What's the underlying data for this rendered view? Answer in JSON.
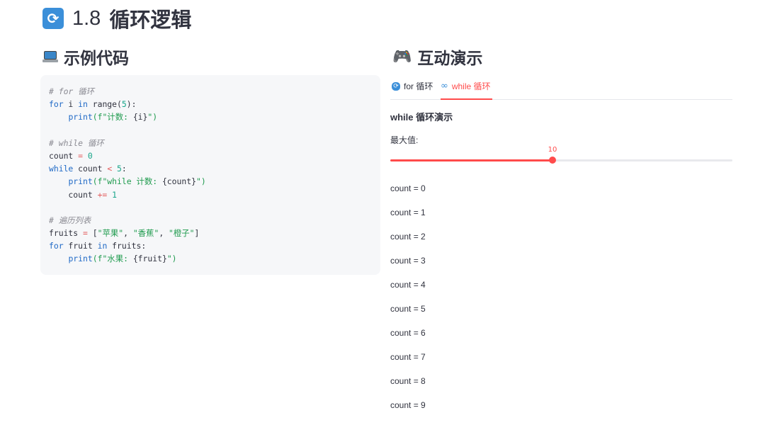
{
  "page": {
    "title_number": "1.8",
    "title_text": "循环逻辑"
  },
  "left": {
    "heading": "示例代码"
  },
  "right": {
    "heading": "互动演示"
  },
  "code_lines": [
    [
      {
        "t": "# for 循环",
        "c": "c-com"
      }
    ],
    [
      {
        "t": "for",
        "c": "c-kw"
      },
      {
        "t": " i ",
        "c": "c-plain"
      },
      {
        "t": "in",
        "c": "c-kw"
      },
      {
        "t": " range(",
        "c": "c-plain"
      },
      {
        "t": "5",
        "c": "c-num"
      },
      {
        "t": "):",
        "c": "c-plain"
      }
    ],
    [
      {
        "t": "    ",
        "c": "c-plain"
      },
      {
        "t": "print",
        "c": "c-fn"
      },
      {
        "t": "(f\"计数: ",
        "c": "c-str"
      },
      {
        "t": "{i}",
        "c": "c-plain"
      },
      {
        "t": "\")",
        "c": "c-str"
      }
    ],
    [],
    [
      {
        "t": "# while 循环",
        "c": "c-com"
      }
    ],
    [
      {
        "t": "count ",
        "c": "c-plain"
      },
      {
        "t": "=",
        "c": "c-op"
      },
      {
        "t": " ",
        "c": "c-plain"
      },
      {
        "t": "0",
        "c": "c-num"
      }
    ],
    [
      {
        "t": "while",
        "c": "c-kw"
      },
      {
        "t": " count ",
        "c": "c-plain"
      },
      {
        "t": "<",
        "c": "c-op"
      },
      {
        "t": " ",
        "c": "c-plain"
      },
      {
        "t": "5",
        "c": "c-num"
      },
      {
        "t": ":",
        "c": "c-plain"
      }
    ],
    [
      {
        "t": "    ",
        "c": "c-plain"
      },
      {
        "t": "print",
        "c": "c-fn"
      },
      {
        "t": "(f\"while 计数: ",
        "c": "c-str"
      },
      {
        "t": "{count}",
        "c": "c-plain"
      },
      {
        "t": "\")",
        "c": "c-str"
      }
    ],
    [
      {
        "t": "    count ",
        "c": "c-plain"
      },
      {
        "t": "+=",
        "c": "c-op"
      },
      {
        "t": " ",
        "c": "c-plain"
      },
      {
        "t": "1",
        "c": "c-num"
      }
    ],
    [],
    [
      {
        "t": "# 遍历列表",
        "c": "c-com"
      }
    ],
    [
      {
        "t": "fruits ",
        "c": "c-plain"
      },
      {
        "t": "=",
        "c": "c-op"
      },
      {
        "t": " [",
        "c": "c-plain"
      },
      {
        "t": "\"苹果\"",
        "c": "c-str"
      },
      {
        "t": ", ",
        "c": "c-plain"
      },
      {
        "t": "\"香蕉\"",
        "c": "c-str"
      },
      {
        "t": ", ",
        "c": "c-plain"
      },
      {
        "t": "\"橙子\"",
        "c": "c-str"
      },
      {
        "t": "]",
        "c": "c-plain"
      }
    ],
    [
      {
        "t": "for",
        "c": "c-kw"
      },
      {
        "t": " fruit ",
        "c": "c-plain"
      },
      {
        "t": "in",
        "c": "c-kw"
      },
      {
        "t": " fruits:",
        "c": "c-plain"
      }
    ],
    [
      {
        "t": "    ",
        "c": "c-plain"
      },
      {
        "t": "print",
        "c": "c-fn"
      },
      {
        "t": "(f\"水果: ",
        "c": "c-str"
      },
      {
        "t": "{fruit}",
        "c": "c-plain"
      },
      {
        "t": "\")",
        "c": "c-str"
      }
    ]
  ],
  "tabs": [
    {
      "label": "for 循环",
      "icon": "refresh-icon",
      "active": false
    },
    {
      "label": "while 循环",
      "icon": "infinity-icon",
      "active": true
    }
  ],
  "demo": {
    "subtitle": "while 循环演示",
    "slider": {
      "label": "最大值:",
      "value": "10",
      "fraction": 0.475
    },
    "outputs": [
      "count = 0",
      "count = 1",
      "count = 2",
      "count = 3",
      "count = 4",
      "count = 5",
      "count = 6",
      "count = 7",
      "count = 8",
      "count = 9"
    ]
  },
  "colors": {
    "accent": "#ff4b4b",
    "keyword": "#1f69c6",
    "string": "#1f9b4e",
    "number": "#17a589",
    "comment": "#8b8b93"
  }
}
